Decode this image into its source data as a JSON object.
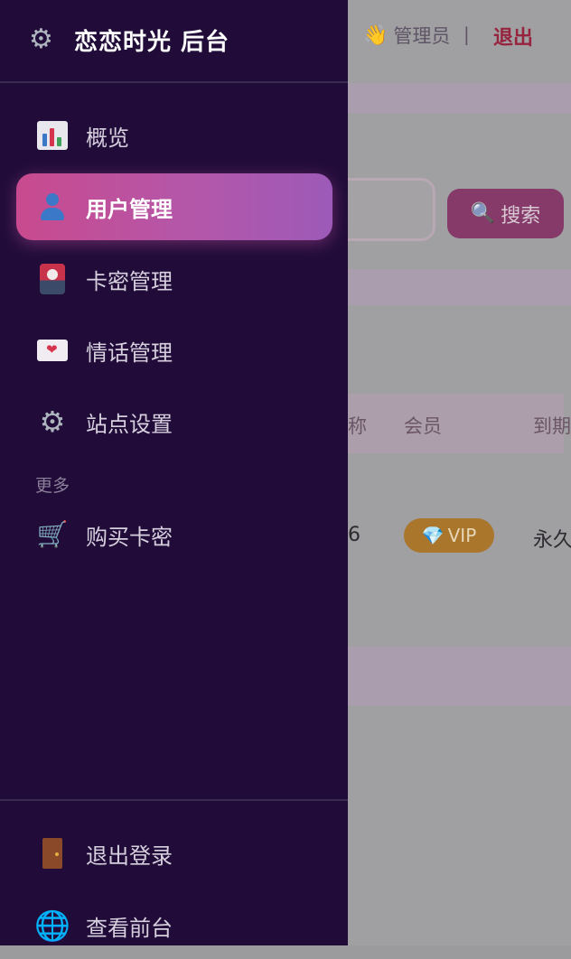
{
  "background": {
    "greeting_icon": "👋",
    "greeting": "管理员",
    "separator": "|",
    "logout": "退出",
    "search_button": {
      "icon": "search-icon",
      "icon_glyph": "🔍",
      "label": "搜索"
    },
    "table": {
      "headers": [
        "称",
        "会员",
        "到期"
      ],
      "row": {
        "name": "6",
        "vip_icon": "💎",
        "vip_label": "VIP",
        "expiry": "永久"
      }
    }
  },
  "drawer": {
    "brand_icon": "gear-icon",
    "brand_title": "恋恋时光 后台",
    "nav": [
      {
        "label": "概览",
        "icon": "chart-icon",
        "active": false
      },
      {
        "label": "用户管理",
        "icon": "user-icon",
        "active": true
      },
      {
        "label": "卡密管理",
        "icon": "card-icon",
        "active": false
      },
      {
        "label": "情话管理",
        "icon": "love-letter-icon",
        "active": false
      },
      {
        "label": "站点设置",
        "icon": "gear-icon",
        "active": false
      }
    ],
    "section_more": "更多",
    "more": [
      {
        "label": "购买卡密",
        "icon": "cart-icon"
      }
    ],
    "footer": [
      {
        "label": "退出登录",
        "icon": "door-icon"
      },
      {
        "label": "查看前台",
        "icon": "globe-icon"
      }
    ]
  },
  "colors": {
    "drawer_bg": "#210c39",
    "active_gradient_start": "#c94a8e",
    "active_gradient_end": "#9d5ab8",
    "logout_text": "#96243e"
  }
}
